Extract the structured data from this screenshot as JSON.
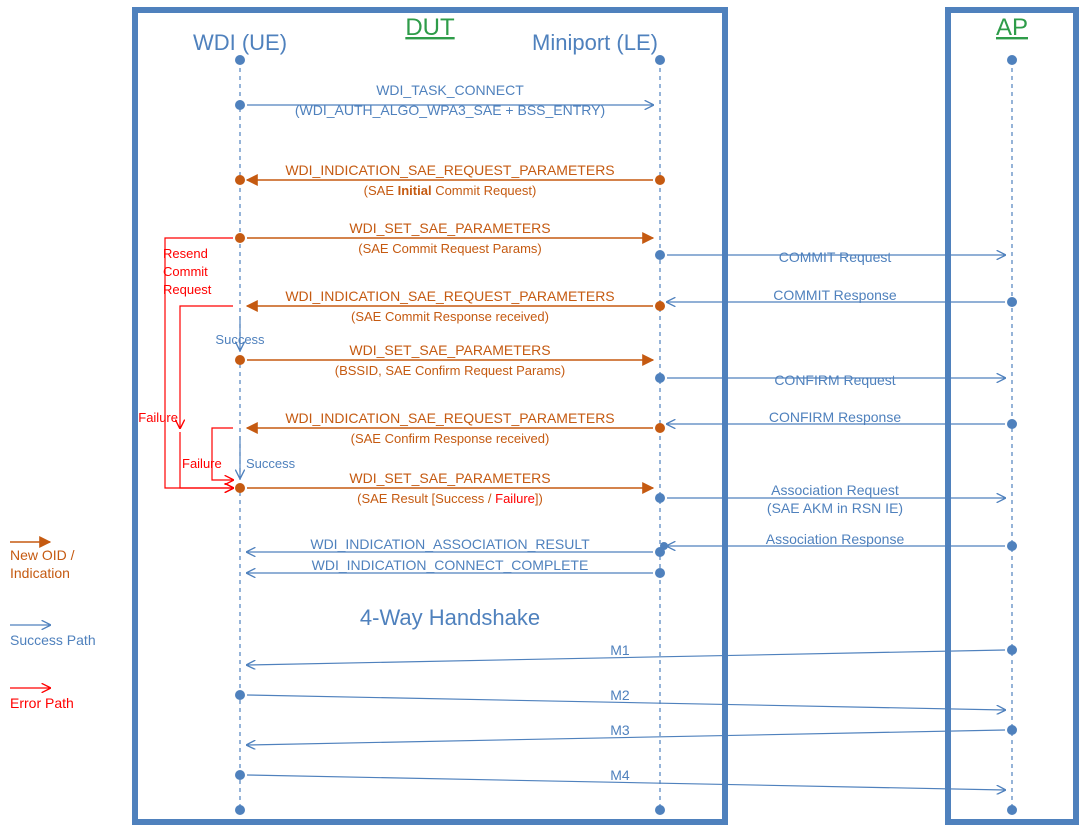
{
  "titles": {
    "dut": "DUT",
    "ap": "AP",
    "wdi": "WDI (UE)",
    "miniport": "Miniport (LE)"
  },
  "msgs": {
    "connect1": "WDI_TASK_CONNECT",
    "connect2": "(WDI_AUTH_ALGO_WPA3_SAE + BSS_ENTRY)",
    "ind_req": "WDI_INDICATION_SAE_REQUEST_PARAMETERS",
    "set_params": "WDI_SET_SAE_PARAMETERS",
    "sub_initial": "(SAE ",
    "sub_initial_bold": "Initial",
    "sub_initial_tail": " Commit Request)",
    "sub_commit_req": "(SAE Commit Request Params)",
    "sub_commit_resp": "(SAE Commit Response received)",
    "sub_confirm_req": "(BSSID, SAE Confirm Request Params)",
    "sub_confirm_resp": "(SAE Confirm Response received)",
    "sub_result_a": "(SAE Result [Success / ",
    "sub_result_fail": "Failure",
    "sub_result_b": "])",
    "assoc_result": "WDI_INDICATION_ASSOCIATION_RESULT",
    "connect_complete": "WDI_INDICATION_CONNECT_COMPLETE",
    "commit_req": "COMMIT Request",
    "commit_resp": "COMMIT Response",
    "confirm_req": "CONFIRM Request",
    "confirm_resp": "CONFIRM Response",
    "assoc_req1": "Association Request",
    "assoc_req2": "(SAE AKM in RSN IE)",
    "assoc_resp": "Association Response",
    "handshake": "4-Way Handshake",
    "m1": "M1",
    "m2": "M2",
    "m3": "M3",
    "m4": "M4",
    "resend1": "Resend",
    "resend2": "Commit",
    "resend3": "Request",
    "success": "Success",
    "failure": "Failure"
  },
  "legend": {
    "new_oid1": "New OID /",
    "new_oid2": "Indication",
    "success_path": "Success Path",
    "error_path": "Error Path"
  }
}
